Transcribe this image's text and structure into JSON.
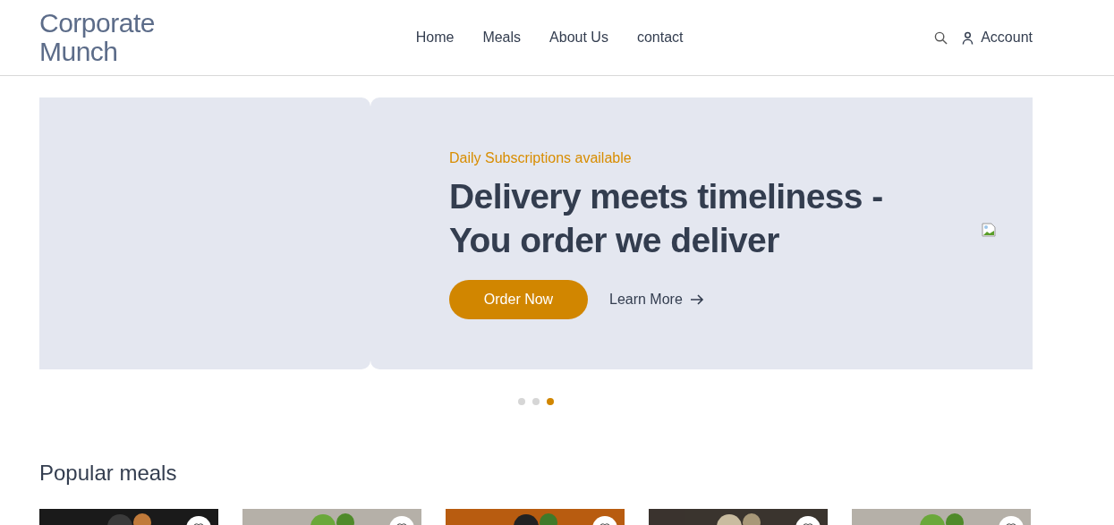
{
  "brand": "Corporate Munch",
  "nav": [
    "Home",
    "Meals",
    "About Us",
    "contact"
  ],
  "account": "Account",
  "hero": {
    "eyebrow": "Daily Subscriptions available",
    "title": "Delivery meets timeliness - You order we deliver",
    "primary_button": "Order Now",
    "secondary_link": "Learn More"
  },
  "slides": [
    {
      "selected": false
    },
    {
      "selected": false
    },
    {
      "selected": true
    }
  ],
  "popular": {
    "title": "Popular meals"
  }
}
